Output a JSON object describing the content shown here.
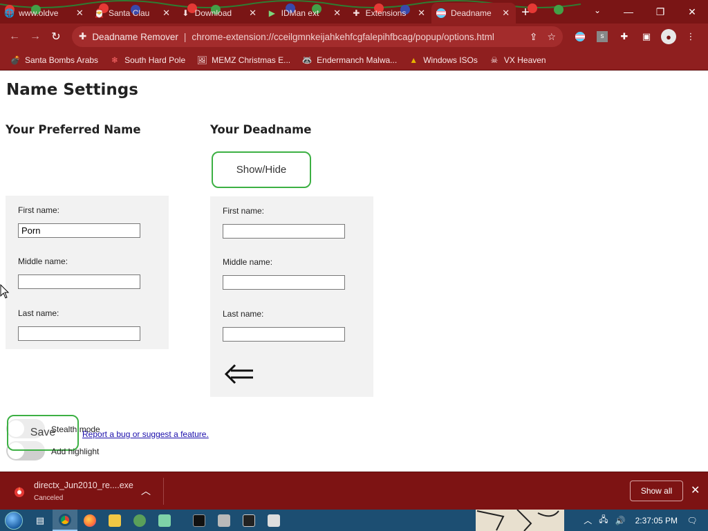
{
  "browser": {
    "tabs": [
      {
        "title": "www.oldve",
        "icon": "globe-icon",
        "active": false
      },
      {
        "title": "Santa Clau",
        "icon": "santa-icon",
        "active": false
      },
      {
        "title": "Download",
        "icon": "download-page-icon",
        "active": false
      },
      {
        "title": "IDMan ext",
        "icon": "idm-icon",
        "active": false
      },
      {
        "title": "Extensions",
        "icon": "puzzle-icon",
        "active": false
      },
      {
        "title": "Deadname",
        "icon": "trans-flag-icon",
        "active": true
      }
    ],
    "close_glyph": "✕",
    "new_tab_glyph": "+",
    "omnibox": {
      "site_name": "Deadname Remover",
      "separator": "|",
      "url": "chrome-extension://cceilgmnkeijahkehfcgfalepihfbcag/popup/options.html"
    },
    "bookmarks": [
      {
        "label": "Santa Bombs Arabs",
        "icon": "bomb-icon"
      },
      {
        "label": "South Hard Pole",
        "icon": "snowflake-icon"
      },
      {
        "label": "MEMZ Christmas E...",
        "icon": "image-icon"
      },
      {
        "label": "Endermanch Malwa...",
        "icon": "raccoon-icon"
      },
      {
        "label": "Windows ISOs",
        "icon": "folder-icon"
      },
      {
        "label": "VX Heaven",
        "icon": "skull-icon"
      }
    ],
    "theme_color": "#8f1f1f"
  },
  "page": {
    "title": "Name Settings",
    "preferred": {
      "heading": "Your Preferred Name",
      "first_label": "First name:",
      "first_value": "Porn",
      "middle_label": "Middle name:",
      "middle_value": "",
      "last_label": "Last name:",
      "last_value": ""
    },
    "deadname": {
      "heading": "Your Deadname",
      "show_hide_label": "Show/Hide",
      "first_label": "First name:",
      "first_value": "",
      "middle_label": "Middle name:",
      "middle_value": "",
      "last_label": "Last name:",
      "last_value": "",
      "arrow_icon": "left-double-arrow-icon"
    },
    "save_label": "Save",
    "stealth_label": "Stealth mode",
    "stealth_on": false,
    "highlight_label": "Add highlight",
    "highlight_on": false,
    "report_link": "Report a bug or suggest a feature.",
    "accent_color": "#3cb043"
  },
  "downloads": {
    "filename": "directx_Jun2010_re....exe",
    "status": "Canceled",
    "show_all_label": "Show all"
  },
  "taskbar": {
    "clock": "2:37:05 PM",
    "color": "#1c4e72"
  }
}
